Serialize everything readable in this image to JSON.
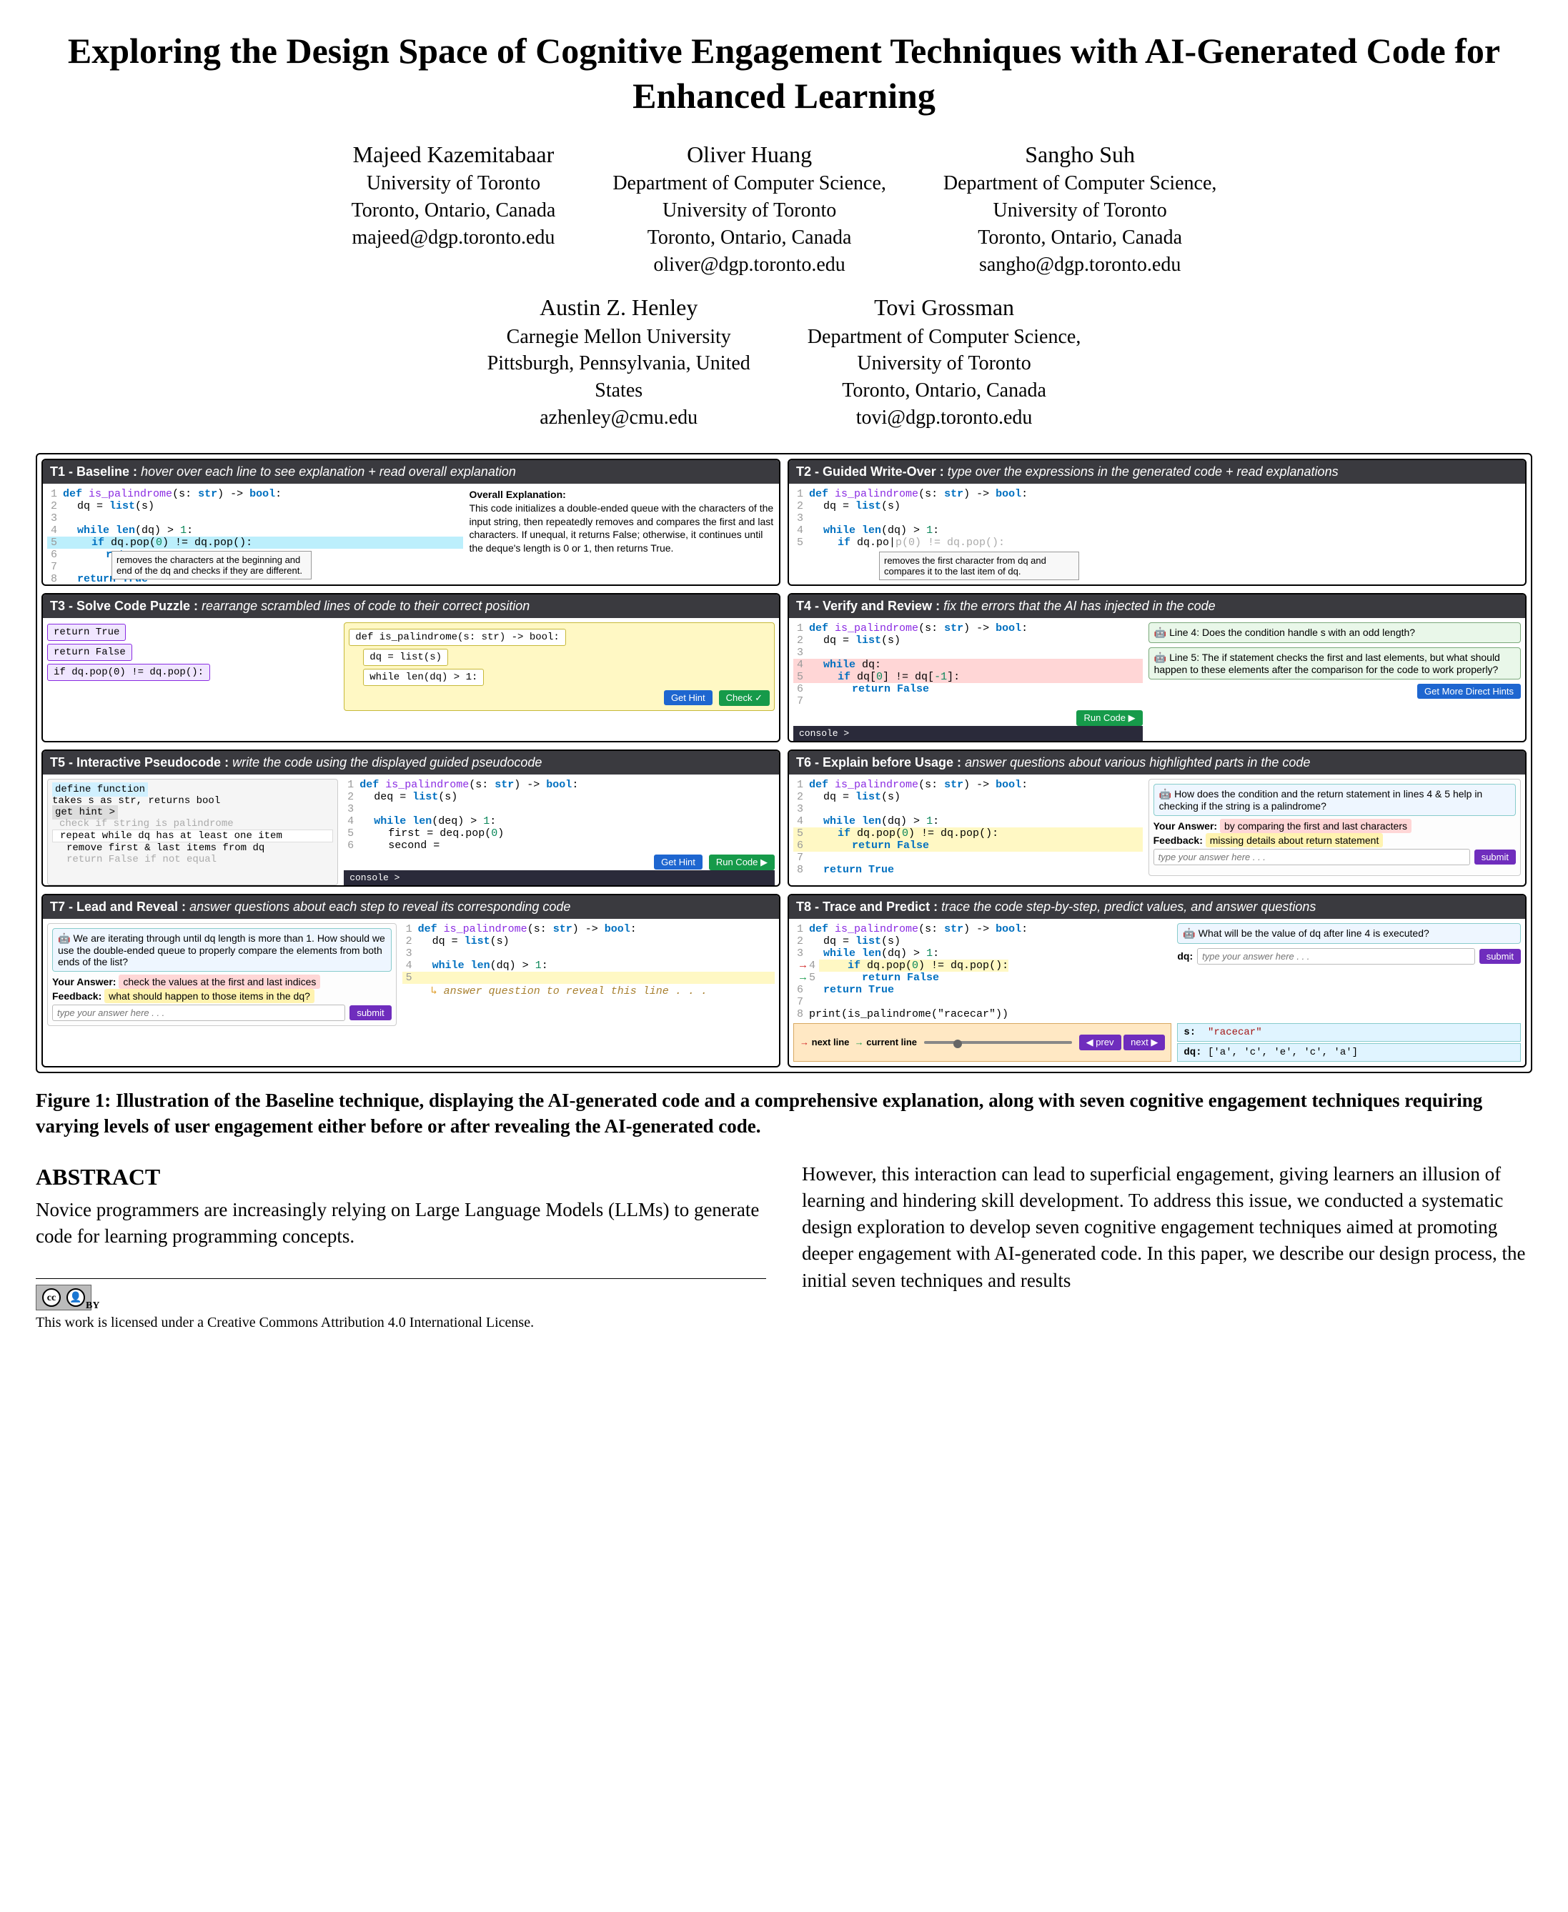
{
  "title": "Exploring the Design Space of Cognitive Engagement Techniques with AI-Generated Code for Enhanced Learning",
  "authors": [
    {
      "name": "Majeed Kazemitabaar",
      "aff1": "University of Toronto",
      "aff2": "Toronto, Ontario, Canada",
      "email": "majeed@dgp.toronto.edu"
    },
    {
      "name": "Oliver Huang",
      "aff1": "Department of Computer Science,",
      "aff2": "University of Toronto",
      "aff3": "Toronto, Ontario, Canada",
      "email": "oliver@dgp.toronto.edu"
    },
    {
      "name": "Sangho Suh",
      "aff1": "Department of Computer Science,",
      "aff2": "University of Toronto",
      "aff3": "Toronto, Ontario, Canada",
      "email": "sangho@dgp.toronto.edu"
    },
    {
      "name": "Austin Z. Henley",
      "aff1": "Carnegie Mellon University",
      "aff2": "Pittsburgh, Pennsylvania, United",
      "aff3": "States",
      "email": "azhenley@cmu.edu"
    },
    {
      "name": "Tovi Grossman",
      "aff1": "Department of Computer Science,",
      "aff2": "University of Toronto",
      "aff3": "Toronto, Ontario, Canada",
      "email": "tovi@dgp.toronto.edu"
    }
  ],
  "panels": {
    "t1": {
      "title": "T1 - Baseline :",
      "desc": "hover over each line to see explanation + read overall explanation",
      "tooltip": "removes the characters at the beginning and end of the dq and checks if they are different.",
      "overall_h": "Overall Explanation:",
      "overall": "This code initializes a double-ended queue with the characters of the input string, then repeatedly removes and compares the first and last characters. If unequal, it returns False; otherwise, it continues until the deque's length is 0 or 1, then returns True."
    },
    "t2": {
      "title": "T2 - Guided Write-Over :",
      "desc": "type over the expressions in the generated code + read explanations",
      "tooltip": "removes the first character from dq and compares it to the last item of dq."
    },
    "t3": {
      "title": "T3 - Solve Code Puzzle :",
      "desc": "rearrange scrambled lines of code to their correct position",
      "chips": [
        "return True",
        "return False",
        "if dq.pop(0) != dq.pop():"
      ],
      "placed": [
        "def is_palindrome(s: str) -> bool:",
        "dq = list(s)",
        "while len(dq) > 1:"
      ],
      "hint": "Get Hint",
      "check": "Check ✓"
    },
    "t4": {
      "title": "T4 - Verify and Review :",
      "desc": "fix the errors that the AI has injected in the code",
      "q1": "Line 4: Does the condition handle s with an odd length?",
      "q2": "Line 5: The if statement checks the first and last elements, but what should happen to these elements after the comparison for the code to work properly?",
      "run": "Run Code ▶",
      "more": "Get More Direct Hints",
      "console": "console >"
    },
    "t5": {
      "title": "T5 - Interactive Pseudocode :",
      "desc": "write the code using the displayed guided pseudocode",
      "pseudo": {
        "define": "define function",
        "takes": "takes s as str, returns bool",
        "hint": "get hint >",
        "check": "check if string is palindrome",
        "repeat": "repeat while dq has at least one item",
        "remove": "remove first & last items from dq",
        "ret": "return False if not equal"
      },
      "getHint": "Get Hint",
      "run": "Run Code ▶",
      "console": "console >"
    },
    "t6": {
      "title": "T6 - Explain before Usage :",
      "desc": "answer questions about various highlighted parts in the code",
      "q": "How does the condition and the return statement in lines 4 & 5 help in checking if the string is a palindrome?",
      "ansLbl": "Your Answer:",
      "ans": "by comparing the first and last characters",
      "fbLbl": "Feedback:",
      "fb": "missing details about return statement",
      "placeholder": "type your answer here . . .",
      "submit": "submit"
    },
    "t7": {
      "title": "T7 - Lead and Reveal :",
      "desc": "answer questions about each step to reveal its corresponding code",
      "q": "We are iterating through until dq length is more than 1. How should we use the double-ended queue to properly compare the elements from both ends of the list?",
      "ansLbl": "Your Answer:",
      "ans": "check the values at the first and last indices",
      "fbLbl": "Feedback:",
      "fb": "what should happen to those items in the dq?",
      "placeholder": "type your answer here . . .",
      "submit": "submit",
      "reveal": "answer question to reveal this line . . ."
    },
    "t8": {
      "title": "T8 - Trace and Predict :",
      "desc": "trace the code step-by-step, predict values, and answer questions",
      "q": "What will be the value of dq after line 4 is executed?",
      "dqLbl": "dq:",
      "placeholder": "type your answer here . . .",
      "submit": "submit",
      "next": "next line",
      "curr": "current line",
      "prev": "◀ prev",
      "nextBtn": "next ▶",
      "sLbl": "s:",
      "sVal": "\"racecar\"",
      "dqVal": "['a', 'c', 'e', 'c', 'a']",
      "printLine": "print(is_palindrome(\"racecar\"))"
    }
  },
  "caption": "Figure 1: Illustration of the Baseline technique, displaying the AI-generated code and a comprehensive explanation, along with seven cognitive engagement techniques requiring varying levels of user engagement either before or after revealing the AI-generated code.",
  "abstract_h": "ABSTRACT",
  "abstract_l": "Novice programmers are increasingly relying on Large Language Models (LLMs) to generate code for learning programming concepts.",
  "abstract_r": "However, this interaction can lead to superficial engagement, giving learners an illusion of learning and hindering skill development. To address this issue, we conducted a systematic design exploration to develop seven cognitive engagement techniques aimed at promoting deeper engagement with AI-generated code. In this paper, we describe our design process, the initial seven techniques and results",
  "license": "This work is licensed under a Creative Commons Attribution 4.0 International License.",
  "cc": {
    "cc": "cc",
    "by": "BY"
  }
}
